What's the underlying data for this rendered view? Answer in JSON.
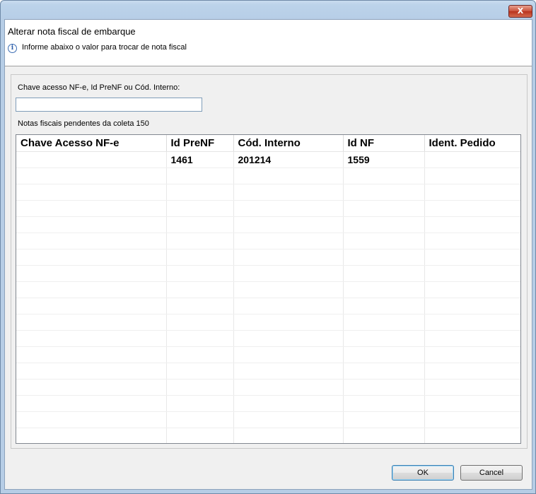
{
  "window": {
    "close_label": "X"
  },
  "header": {
    "title": "Alterar nota fiscal de embarque",
    "info_icon": "i",
    "message": "Informe abaixo o valor para trocar de nota fiscal"
  },
  "search": {
    "label": "Chave acesso NF-e, Id PreNF ou Cód. Interno:",
    "value": ""
  },
  "table": {
    "label": "Notas fiscais pendentes da coleta 150",
    "columns": [
      "Chave Acesso NF-e",
      "Id PreNF",
      "Cód. Interno",
      "Id NF",
      "Ident. Pedido"
    ],
    "rows": [
      [
        "",
        "1461",
        "201214",
        "1559",
        ""
      ]
    ]
  },
  "buttons": {
    "ok": "OK",
    "cancel": "Cancel"
  },
  "icons": {
    "close": "close-icon",
    "info": "info-icon"
  },
  "colors": {
    "window_frame": "#b6cde6",
    "ok_border": "#3c7fb1"
  }
}
